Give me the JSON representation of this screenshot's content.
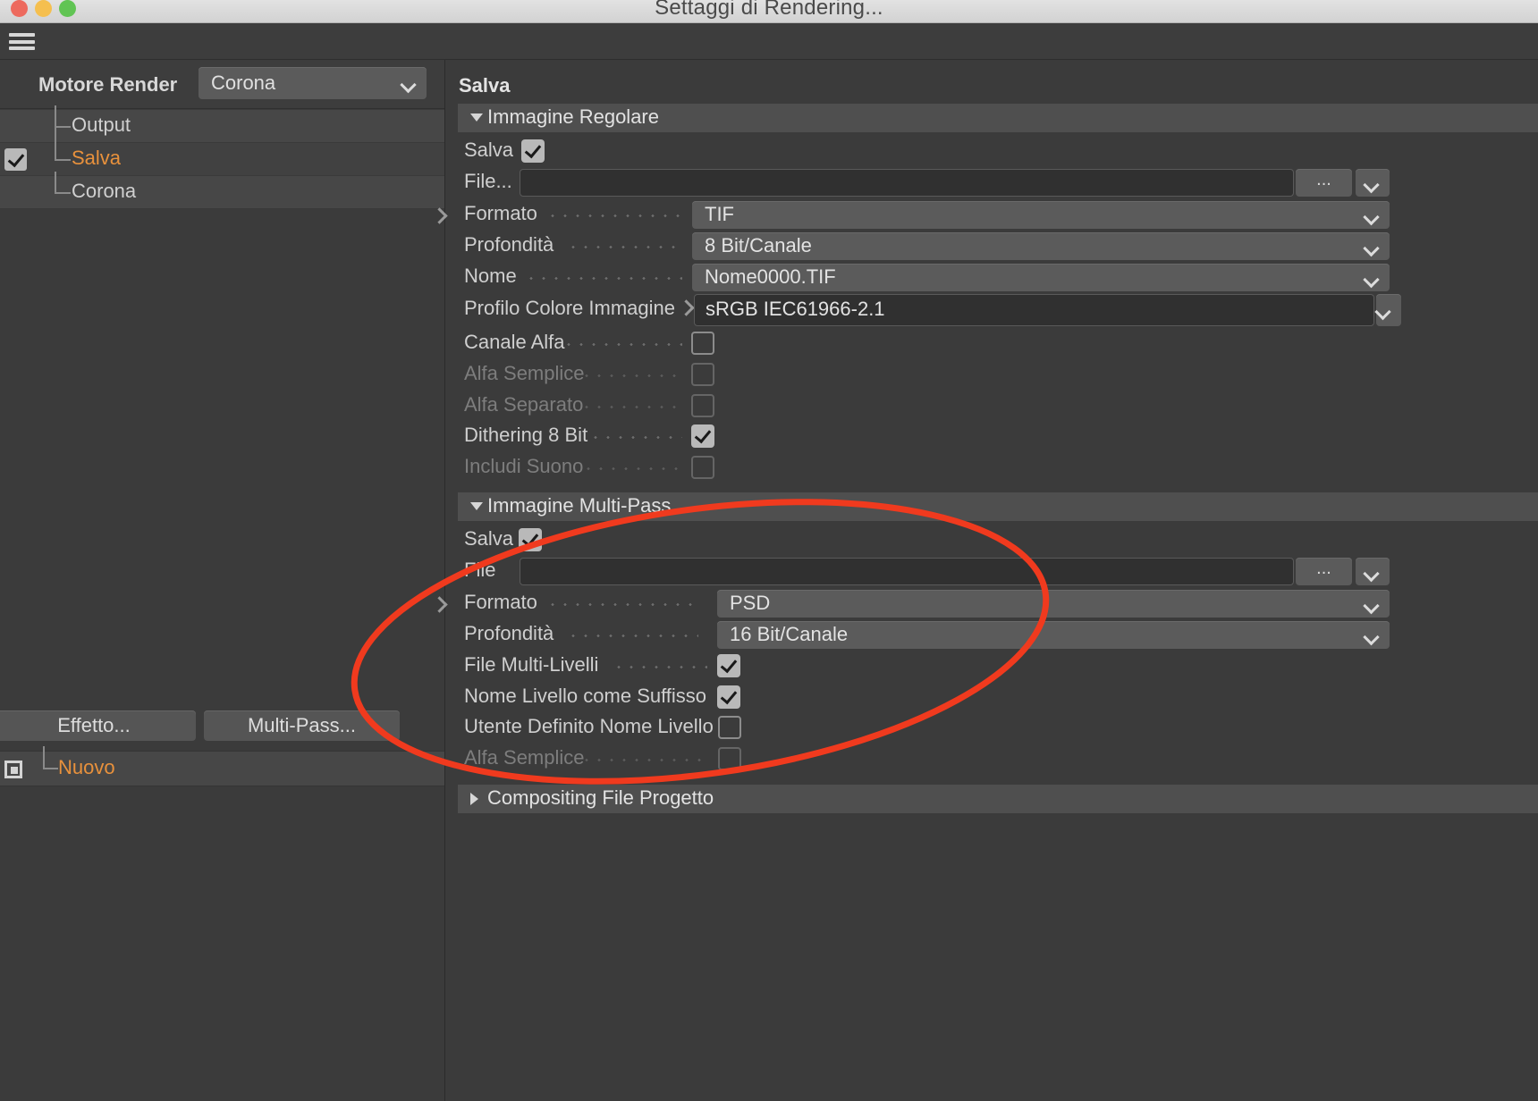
{
  "window": {
    "title": "Settaggi di Rendering...",
    "traffic_lights": [
      "close",
      "minimize",
      "zoom"
    ],
    "menu_icon": "hamburger-icon"
  },
  "left_panel": {
    "engine": {
      "label": "Motore Render",
      "value": "Corona",
      "options": [
        "Corona"
      ]
    },
    "tree": [
      {
        "label": "Output",
        "checked": false,
        "selected": false
      },
      {
        "label": "Salva",
        "checked": true,
        "selected": true
      },
      {
        "label": "Corona",
        "checked": false,
        "selected": false
      }
    ],
    "buttons": {
      "effetto": "Effetto...",
      "multipass": "Multi-Pass..."
    },
    "preset": {
      "label": "Nuovo",
      "icon": "render-region-icon"
    }
  },
  "right_panel": {
    "title": "Salva",
    "sections": [
      {
        "title": "Immagine Regolare",
        "expanded": true,
        "rows": [
          {
            "label": "Salva",
            "type": "checkbox",
            "value": true,
            "dots": false
          },
          {
            "label": "File...",
            "type": "file",
            "value": "",
            "buttons": [
              "...",
              "chevron-down-icon"
            ]
          },
          {
            "label": "Formato",
            "type": "select",
            "value": "TIF",
            "expandable": true
          },
          {
            "label": "Profondità",
            "type": "select",
            "value": "8 Bit/Canale"
          },
          {
            "label": "Nome",
            "type": "select",
            "value": "Nome0000.TIF"
          },
          {
            "label": "Profilo Colore Immagine",
            "type": "profile",
            "value": "sRGB IEC61966-2.1",
            "arrow": true
          },
          {
            "label": "Canale Alfa",
            "type": "checkbox",
            "value": false
          },
          {
            "label": "Alfa Semplice",
            "type": "checkbox",
            "value": false,
            "disabled": true
          },
          {
            "label": "Alfa Separato",
            "type": "checkbox",
            "value": false,
            "disabled": true
          },
          {
            "label": "Dithering 8 Bit",
            "type": "checkbox",
            "value": true
          },
          {
            "label": "Includi Suono",
            "type": "checkbox",
            "value": false,
            "disabled": true
          }
        ]
      },
      {
        "title": "Immagine Multi-Pass",
        "expanded": true,
        "rows": [
          {
            "label": "Salva",
            "type": "checkbox",
            "value": true
          },
          {
            "label": "File",
            "type": "file",
            "value": "",
            "buttons": [
              "...",
              "chevron-down-icon"
            ]
          },
          {
            "label": "Formato",
            "type": "select",
            "value": "PSD",
            "expandable": true
          },
          {
            "label": "Profondità",
            "type": "select",
            "value": "16 Bit/Canale"
          },
          {
            "label": "File Multi-Livelli",
            "type": "checkbox",
            "value": true
          },
          {
            "label": "Nome Livello come Suffisso",
            "type": "checkbox",
            "value": true
          },
          {
            "label": "Utente Definito Nome Livello",
            "type": "checkbox",
            "value": false
          },
          {
            "label": "Alfa Semplice",
            "type": "checkbox",
            "value": false,
            "disabled": true
          }
        ]
      },
      {
        "title": "Compositing File Progetto",
        "expanded": false,
        "rows": []
      }
    ]
  },
  "annotation": {
    "shape": "ellipse",
    "color": "#f03a1e",
    "stroke_width": 7
  }
}
